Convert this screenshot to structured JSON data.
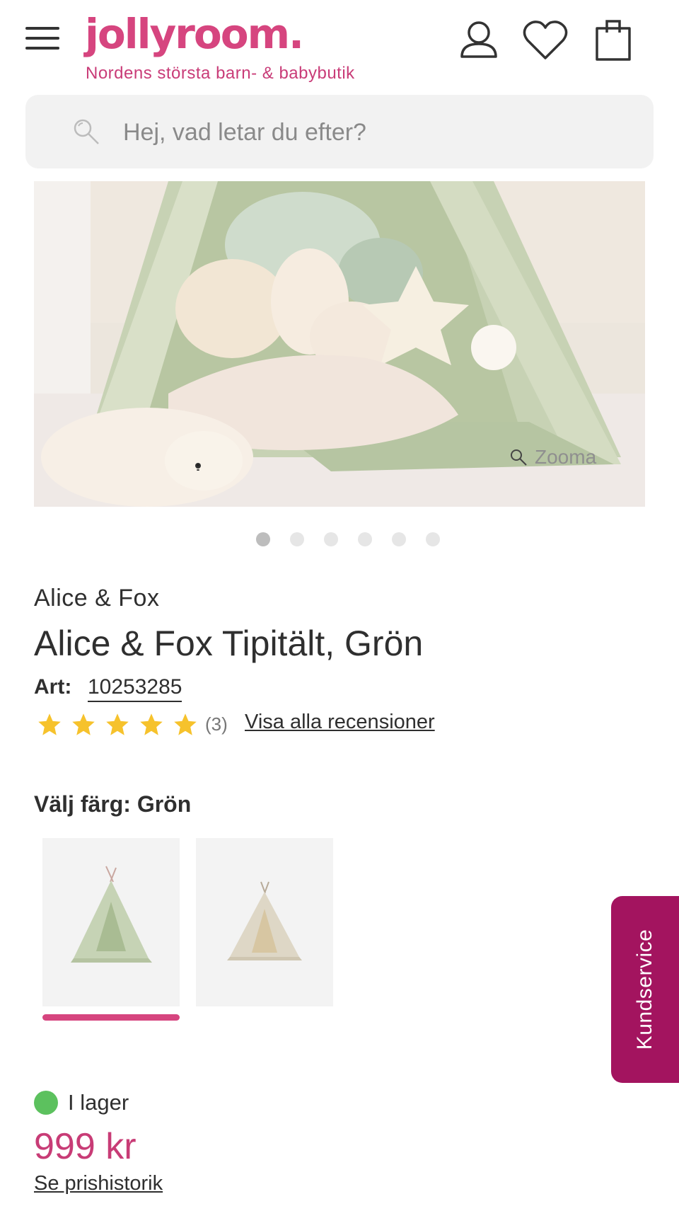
{
  "header": {
    "logo": "jollyroom.",
    "tagline": "Nordens största barn- & babybutik"
  },
  "search": {
    "placeholder": "Hej, vad letar du efter?"
  },
  "gallery": {
    "zoom_label": "Zooma",
    "slide_count": 6,
    "active_slide": 1
  },
  "product": {
    "brand": "Alice & Fox",
    "title": "Alice & Fox Tipitält, Grön",
    "art_label": "Art:",
    "art_number": "10253285",
    "rating": 5,
    "review_count": "(3)",
    "reviews_link": "Visa alla recensioner"
  },
  "color": {
    "label": "Välj färg:",
    "selected": "Grön",
    "options": [
      "green-tent",
      "beige-tent"
    ]
  },
  "stock": {
    "status": "I lager"
  },
  "price": {
    "amount": "999 kr",
    "history_link": "Se prishistorik"
  },
  "side_tab": {
    "label": "Kundservice"
  },
  "colors": {
    "brand": "#d6457f",
    "kundservice": "#a3145f",
    "in_stock": "#5cc15e",
    "price": "#c83c76",
    "star": "#f6c22c"
  }
}
